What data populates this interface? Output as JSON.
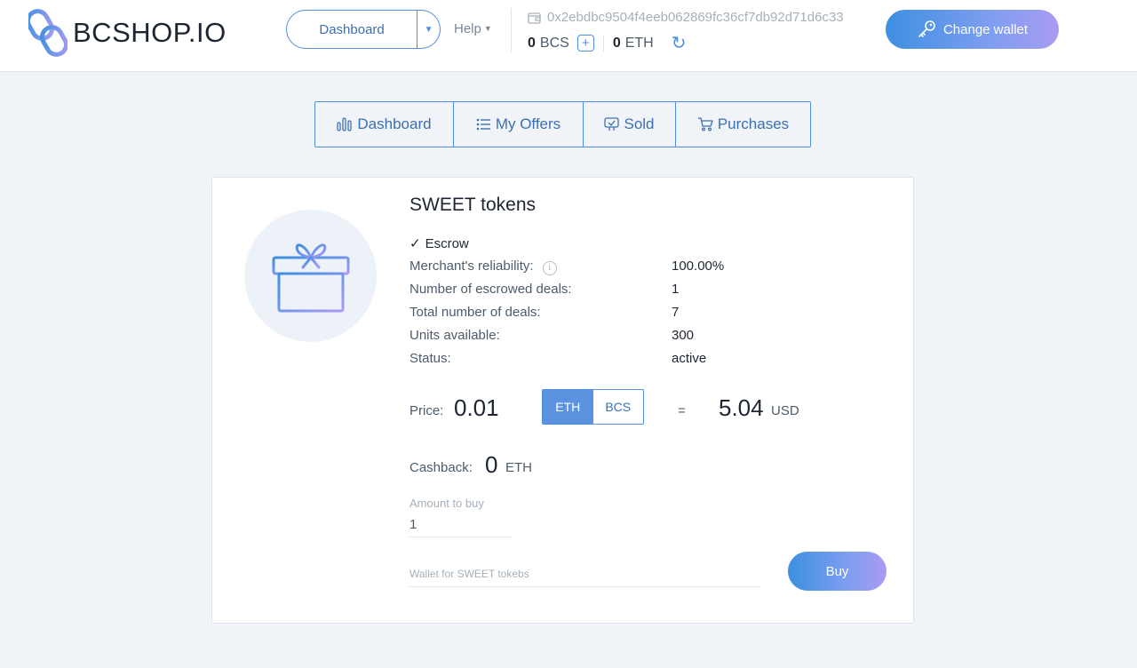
{
  "header": {
    "logo_text": "BCSHOP.IO",
    "nav_select_value": "Dashboard",
    "help_label": "Help",
    "wallet_address": "0x2ebdbc9504f4eeb062869fc36cf7db92d71d6c33",
    "bcs_balance": "0",
    "bcs_unit": "BCS",
    "eth_balance": "0",
    "eth_unit": "ETH",
    "change_wallet_label": "Change wallet"
  },
  "tabs": [
    {
      "label": "Dashboard",
      "icon": "bar-chart-icon"
    },
    {
      "label": "My Offers",
      "icon": "list-icon"
    },
    {
      "label": "Sold",
      "icon": "sold-icon"
    },
    {
      "label": "Purchases",
      "icon": "cart-icon"
    }
  ],
  "offer": {
    "image_icon": "gift-icon",
    "title": "SWEET tokens",
    "escrow_label": "Escrow",
    "details": [
      {
        "label": "Merchant's reliability:",
        "value": "100.00%"
      },
      {
        "label": "Number of escrowed deals:",
        "value": "1"
      },
      {
        "label": "Total number of deals:",
        "value": "7"
      },
      {
        "label": "Units available:",
        "value": "300"
      },
      {
        "label": "Status:",
        "value": "active"
      }
    ],
    "price_label": "Price:",
    "price_value": "0.01",
    "currency_options": [
      "ETH",
      "BCS"
    ],
    "currency_selected": "ETH",
    "equals": "=",
    "usd_value": "5.04",
    "usd_unit": "USD",
    "cashback_label": "Cashback:",
    "cashback_value": "0",
    "cashback_unit": "ETH",
    "amount_label": "Amount to buy",
    "amount_value": "1",
    "wallet_placeholder": "Wallet for SWEET tokebs",
    "buy_label": "Buy"
  },
  "colors": {
    "accent": "#4f8fe0",
    "background": "#f0f4f9",
    "gradient_start": "#3d8fe0",
    "gradient_end": "#a99cf2"
  }
}
